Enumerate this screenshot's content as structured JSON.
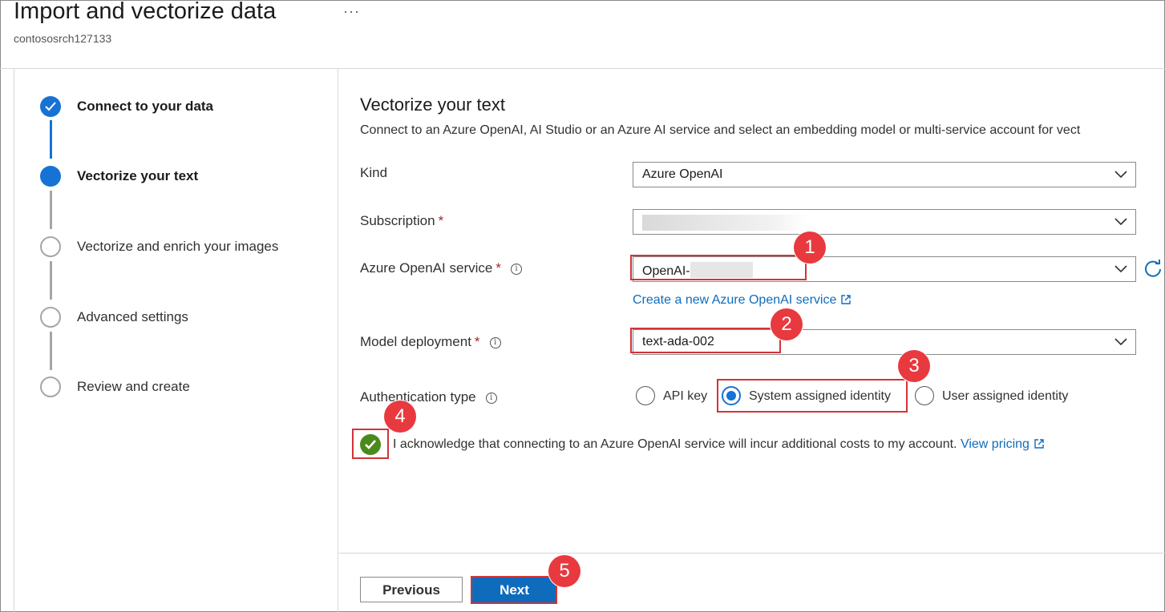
{
  "header": {
    "title": "Import and vectorize data",
    "more_label": "···",
    "subtitle": "contososrch127133"
  },
  "steps": [
    {
      "label": "Connect to your data",
      "state": "done"
    },
    {
      "label": "Vectorize your text",
      "state": "current"
    },
    {
      "label": "Vectorize and enrich your images",
      "state": "todo"
    },
    {
      "label": "Advanced settings",
      "state": "todo"
    },
    {
      "label": "Review and create",
      "state": "todo"
    }
  ],
  "main": {
    "title": "Vectorize your text",
    "description": "Connect to an Azure OpenAI, AI Studio or an Azure AI service and select an embedding model or multi-service account for vect",
    "fields": {
      "kind": {
        "label": "Kind",
        "value": "Azure OpenAI"
      },
      "subscription": {
        "label": "Subscription",
        "required": "*",
        "value": ""
      },
      "service": {
        "label": "Azure OpenAI service",
        "required": "*",
        "value": "OpenAI-",
        "info": "i"
      },
      "create_link": "Create a new Azure OpenAI service",
      "model": {
        "label": "Model deployment",
        "required": "*",
        "value": "text-ada-002",
        "info": "i"
      },
      "auth": {
        "label": "Authentication type",
        "info": "i",
        "options": [
          "API key",
          "System assigned identity",
          "User assigned identity"
        ],
        "selected": "System assigned identity"
      }
    },
    "acknowledge": {
      "text": "I acknowledge that connecting to an Azure OpenAI service will incur additional costs to my account.",
      "link": "View pricing",
      "checked": true
    },
    "buttons": {
      "previous": "Previous",
      "next": "Next"
    }
  },
  "annotations": [
    "1",
    "2",
    "3",
    "4",
    "5"
  ],
  "colors": {
    "accent": "#0f6cbd",
    "step_blue": "#1672d4",
    "highlight": "#d13438",
    "badge": "#e8393f",
    "check_green": "#4a8a1c"
  }
}
